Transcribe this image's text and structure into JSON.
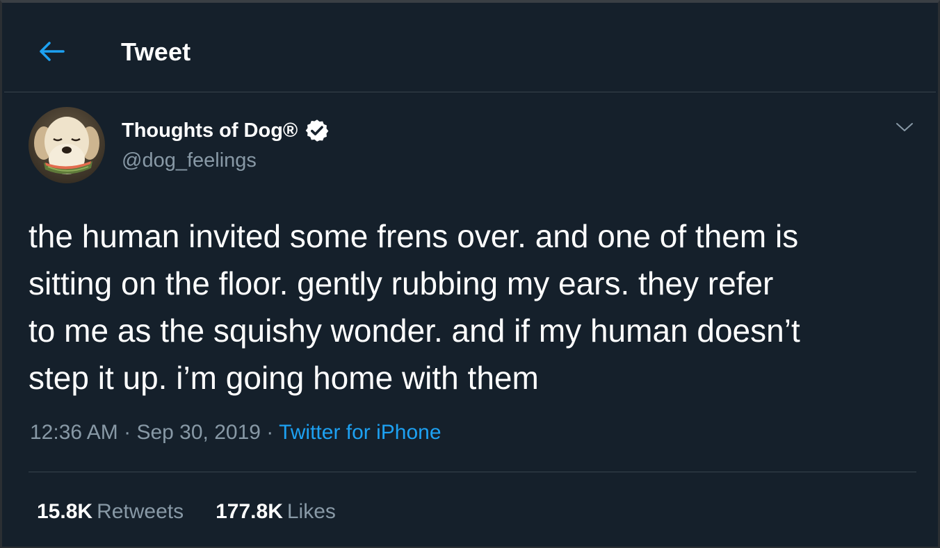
{
  "header": {
    "back_icon": "arrow-left-icon",
    "title": "Tweet"
  },
  "tweet": {
    "author": {
      "display_name": "Thoughts of Dog®",
      "handle": "@dog_feelings",
      "verified": true,
      "avatar": "dog-with-watermelon-avatar"
    },
    "menu_icon": "chevron-down-icon",
    "text_lines": [
      "the human invited some frens over. and one of them is",
      "sitting on the floor. gently rubbing my ears. they refer",
      "to me as the squishy wonder. and if my human doesn’t",
      "step it up. i’m going home with them"
    ],
    "time": "12:36 AM",
    "date": "Sep 30, 2019",
    "separator": "·",
    "source": "Twitter for iPhone",
    "stats": {
      "retweets_count": "15.8K",
      "retweets_label": "Retweets",
      "likes_count": "177.8K",
      "likes_label": "Likes"
    }
  },
  "colors": {
    "background": "#15202b",
    "border": "#38444d",
    "secondary_text": "#8899a6",
    "accent": "#1da1f2"
  }
}
